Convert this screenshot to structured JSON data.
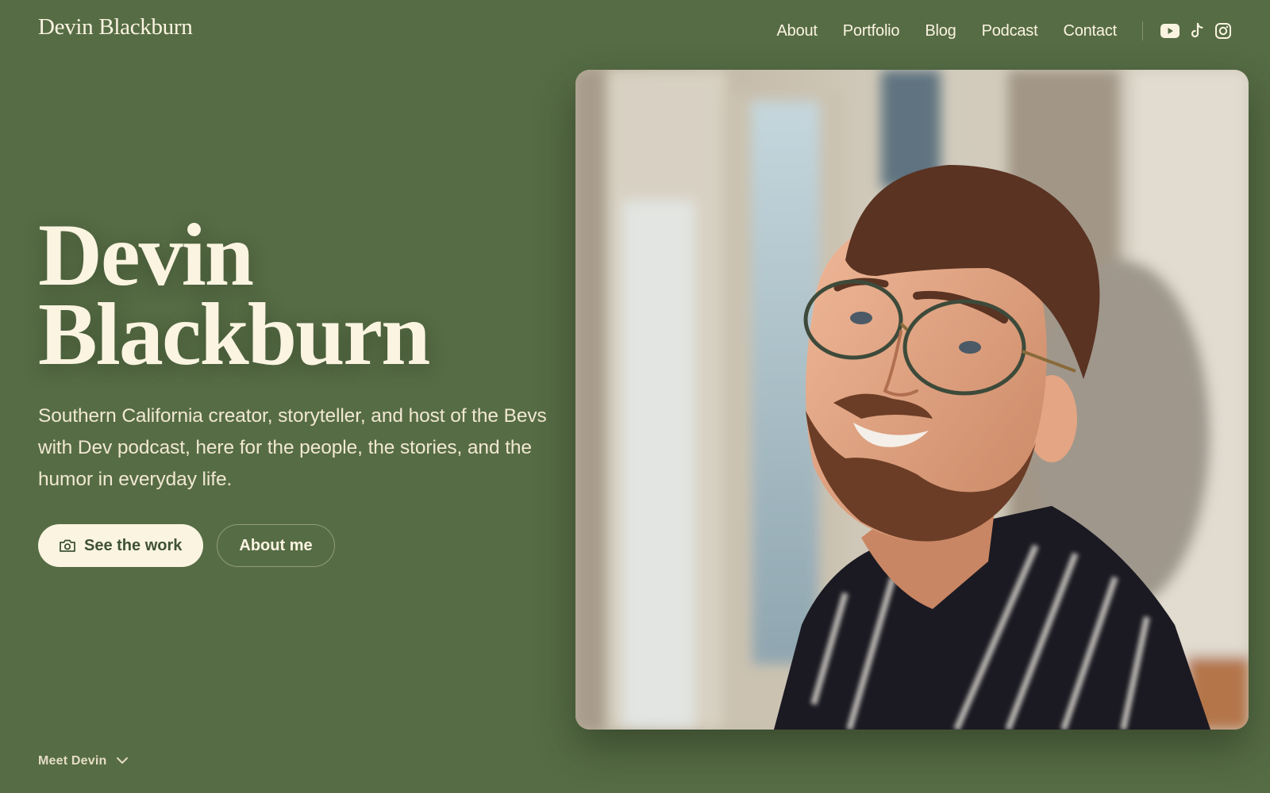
{
  "header": {
    "brand": "Devin Blackburn",
    "nav": [
      "About",
      "Portfolio",
      "Blog",
      "Podcast",
      "Contact"
    ],
    "social_icons": [
      "youtube-icon",
      "tiktok-icon",
      "instagram-icon"
    ]
  },
  "hero": {
    "title_line1": "Devin",
    "title_line2": "Blackburn",
    "description": "Southern California creator, storyteller, and host of the Bevs with Dev podcast, here for the people, the stories, and the humor in everyday life.",
    "primary_button": "See the work",
    "primary_button_icon": "camera-icon",
    "secondary_button": "About me",
    "scroll_hint": "Meet Devin",
    "scroll_hint_icon": "chevron-down-icon"
  },
  "colors": {
    "background": "#566c45",
    "cream": "#fbf4e1",
    "button_text": "#3f5233"
  }
}
